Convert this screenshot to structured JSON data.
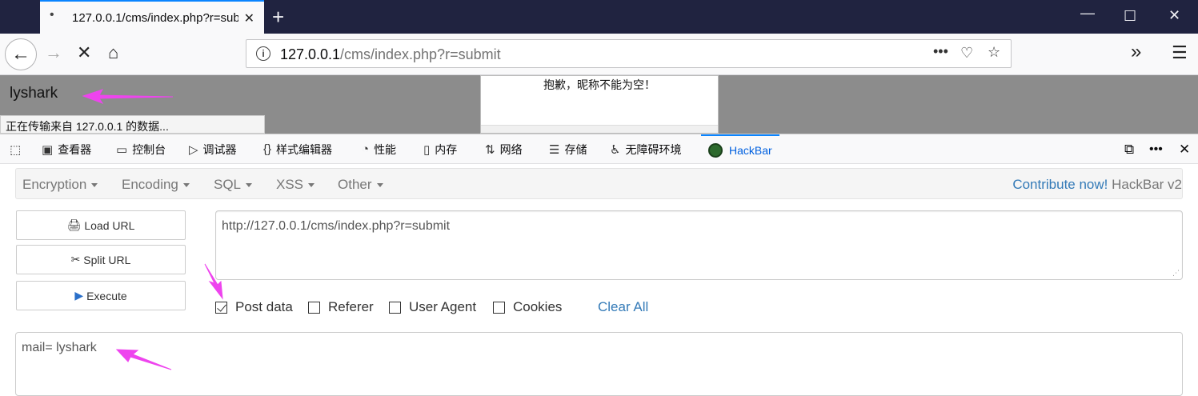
{
  "browser": {
    "tab_title": "127.0.0.1/cms/index.php?r=submit",
    "url_host": "127.0.0.1",
    "url_path": "/cms/index.php?r=submit",
    "status_text": "正在传输来自 127.0.0.1 的数据..."
  },
  "page": {
    "username": "lyshark",
    "message": "抱歉，昵称不能为空！"
  },
  "devtools": {
    "tabs": [
      {
        "label": "查看器",
        "icon": "inspector-icon"
      },
      {
        "label": "控制台",
        "icon": "console-icon"
      },
      {
        "label": "调试器",
        "icon": "debugger-icon"
      },
      {
        "label": "样式编辑器",
        "icon": "style-editor-icon"
      },
      {
        "label": "性能",
        "icon": "performance-icon"
      },
      {
        "label": "内存",
        "icon": "memory-icon"
      },
      {
        "label": "网络",
        "icon": "network-icon"
      },
      {
        "label": "存储",
        "icon": "storage-icon"
      },
      {
        "label": "无障碍环境",
        "icon": "accessibility-icon"
      },
      {
        "label": "HackBar",
        "icon": "hackbar-icon",
        "active": true
      }
    ]
  },
  "hackbar": {
    "menus": [
      "Encryption",
      "Encoding",
      "SQL",
      "XSS",
      "Other"
    ],
    "contribute_link": "Contribute now!",
    "version": "HackBar v2",
    "buttons": {
      "load": "Load URL",
      "split": "Split URL",
      "execute": "Execute"
    },
    "url_value": "http://127.0.0.1/cms/index.php?r=submit",
    "options": [
      {
        "label": "Post data",
        "checked": true
      },
      {
        "label": "Referer",
        "checked": false
      },
      {
        "label": "User Agent",
        "checked": false
      },
      {
        "label": "Cookies",
        "checked": false
      }
    ],
    "clear_all": "Clear All",
    "post_value": "mail= lyshark"
  },
  "colors": {
    "annotation_arrow": "#ee44ee",
    "accent": "#0a84ff",
    "link": "#337ab7"
  }
}
